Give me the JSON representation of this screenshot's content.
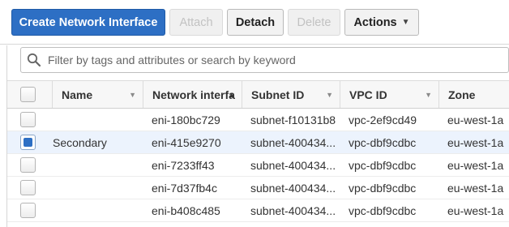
{
  "toolbar": {
    "create_label": "Create Network Interface",
    "attach_label": "Attach",
    "detach_label": "Detach",
    "delete_label": "Delete",
    "actions_label": "Actions"
  },
  "filter": {
    "placeholder": "Filter by tags and attributes or search by keyword"
  },
  "table": {
    "headers": {
      "name": "Name",
      "network_interface": "Network interfa",
      "subnet": "Subnet ID",
      "vpc": "VPC ID",
      "zone": "Zone"
    },
    "rows": [
      {
        "selected": false,
        "name": "",
        "eni": "eni-180bc729",
        "subnet": "subnet-f10131b8",
        "vpc": "vpc-2ef9cd49",
        "zone": "eu-west-1a"
      },
      {
        "selected": true,
        "name": "Secondary",
        "eni": "eni-415e9270",
        "subnet": "subnet-400434...",
        "vpc": "vpc-dbf9cdbc",
        "zone": "eu-west-1a"
      },
      {
        "selected": false,
        "name": "",
        "eni": "eni-7233ff43",
        "subnet": "subnet-400434...",
        "vpc": "vpc-dbf9cdbc",
        "zone": "eu-west-1a"
      },
      {
        "selected": false,
        "name": "",
        "eni": "eni-7d37fb4c",
        "subnet": "subnet-400434...",
        "vpc": "vpc-dbf9cdbc",
        "zone": "eu-west-1a"
      },
      {
        "selected": false,
        "name": "",
        "eni": "eni-b408c485",
        "subnet": "subnet-400434...",
        "vpc": "vpc-dbf9cdbc",
        "zone": "eu-west-1a"
      }
    ]
  },
  "colors": {
    "primary": "#2d6fc4",
    "selected_row": "#ecf3fd"
  }
}
